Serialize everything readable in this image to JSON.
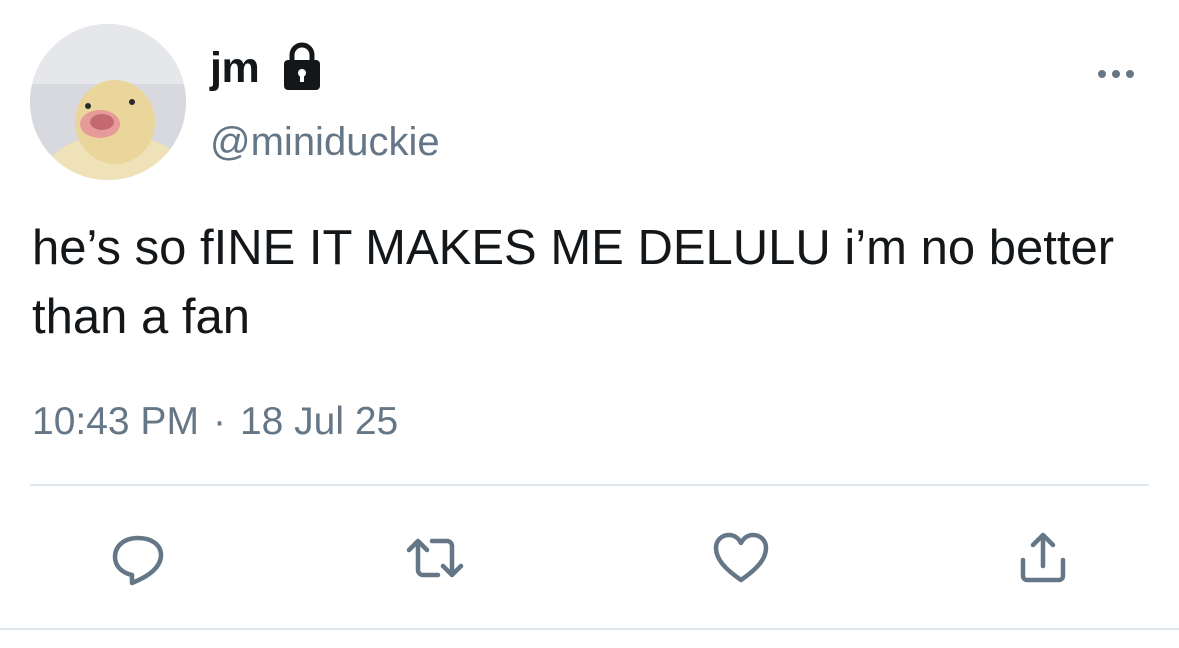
{
  "tweet": {
    "display_name": "jm",
    "handle": "@miniduckie",
    "text": "he’s so fINE IT MAKES ME DELULU i’m no better than a fan",
    "time": "10:43 PM",
    "separator": "·",
    "date": "18 Jul 25",
    "protected_icon": "lock-icon",
    "more_icon": "more-options-icon"
  },
  "actions": [
    {
      "name": "reply",
      "icon": "reply-icon"
    },
    {
      "name": "retweet",
      "icon": "retweet-icon"
    },
    {
      "name": "like",
      "icon": "heart-icon"
    },
    {
      "name": "share",
      "icon": "share-icon"
    }
  ],
  "colors": {
    "text": "#14171a",
    "secondary": "#657786",
    "icon": "#657786",
    "divider": "#e1e8ed"
  }
}
